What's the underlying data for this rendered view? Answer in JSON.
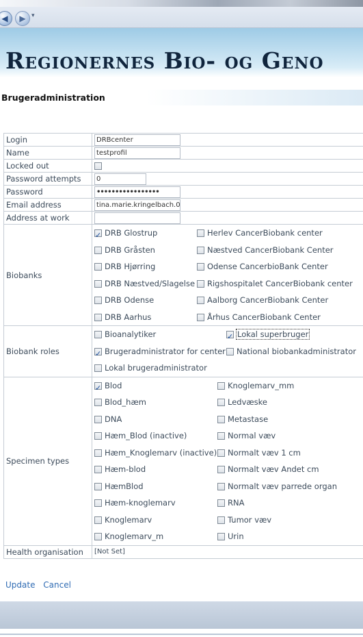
{
  "header": {
    "title": "Regionernes Bio- og Geno"
  },
  "page": {
    "title": "Brugeradministration"
  },
  "fields": {
    "login": {
      "label": "Login",
      "value": "DRBcenter"
    },
    "name": {
      "label": "Name",
      "value": "testprofil"
    },
    "locked_out": {
      "label": "Locked out",
      "checked": false
    },
    "password_attempts": {
      "label": "Password attempts",
      "value": "0"
    },
    "password": {
      "label": "Password",
      "value": "•••••••••••••••••"
    },
    "email": {
      "label": "Email address",
      "value": "tina.marie.kringelbach.0"
    },
    "address": {
      "label": "Address at work",
      "value": ""
    },
    "health": {
      "label": "Health organisation",
      "value": "[Not Set]"
    }
  },
  "biobanks": {
    "label": "Biobanks",
    "items": [
      {
        "label": "DRB Glostrup",
        "checked": true
      },
      {
        "label": "Herlev CancerBiobank center",
        "checked": false
      },
      {
        "label": "DRB Gråsten",
        "checked": false
      },
      {
        "label": "Næstved CancerBiobank Center",
        "checked": false
      },
      {
        "label": "DRB Hjørring",
        "checked": false
      },
      {
        "label": "Odense CancerbioBank Center",
        "checked": false
      },
      {
        "label": "DRB Næstved/Slagelse",
        "checked": false
      },
      {
        "label": "Rigshospitalet CancerBiobank center",
        "checked": false
      },
      {
        "label": "DRB Odense",
        "checked": false
      },
      {
        "label": "Aalborg CancerBiobank Center",
        "checked": false
      },
      {
        "label": "DRB Aarhus",
        "checked": false
      },
      {
        "label": "Århus CancerBiobank Center",
        "checked": false
      }
    ]
  },
  "roles": {
    "label": "Biobank roles",
    "items": [
      {
        "label": "Bioanalytiker",
        "checked": false
      },
      {
        "label": "Lokal superbruger",
        "checked": true
      },
      {
        "label": "Brugeradministrator for center",
        "checked": true
      },
      {
        "label": "National biobankadministrator",
        "checked": false
      },
      {
        "label": "Lokal brugeradministrator",
        "checked": false
      }
    ]
  },
  "specimens": {
    "label": "Specimen types",
    "items": [
      {
        "label": "Blod",
        "checked": true
      },
      {
        "label": "Knoglemarv_mm",
        "checked": false
      },
      {
        "label": "Blod_hæm",
        "checked": false
      },
      {
        "label": "Ledvæske",
        "checked": false
      },
      {
        "label": "DNA",
        "checked": false
      },
      {
        "label": "Metastase",
        "checked": false
      },
      {
        "label": "Hæm_Blod (inactive)",
        "checked": false
      },
      {
        "label": "Normal væv",
        "checked": false
      },
      {
        "label": "Hæm_Knoglemarv (inactive)",
        "checked": false
      },
      {
        "label": "Normalt væv 1 cm",
        "checked": false
      },
      {
        "label": "Hæm-blod",
        "checked": false
      },
      {
        "label": "Normalt væv Andet cm",
        "checked": false
      },
      {
        "label": "HæmBlod",
        "checked": false
      },
      {
        "label": "Normalt væv parrede organ",
        "checked": false
      },
      {
        "label": "Hæm-knoglemarv",
        "checked": false
      },
      {
        "label": "RNA",
        "checked": false
      },
      {
        "label": "Knoglemarv",
        "checked": false
      },
      {
        "label": "Tumor væv",
        "checked": false
      },
      {
        "label": "Knoglemarv_m",
        "checked": false
      },
      {
        "label": "Urin",
        "checked": false
      }
    ]
  },
  "actions": {
    "update": "Update",
    "cancel": "Cancel"
  },
  "icons": {
    "back": "back-arrow-icon",
    "forward": "forward-arrow-icon",
    "dropdown": "chevron-down-icon"
  }
}
